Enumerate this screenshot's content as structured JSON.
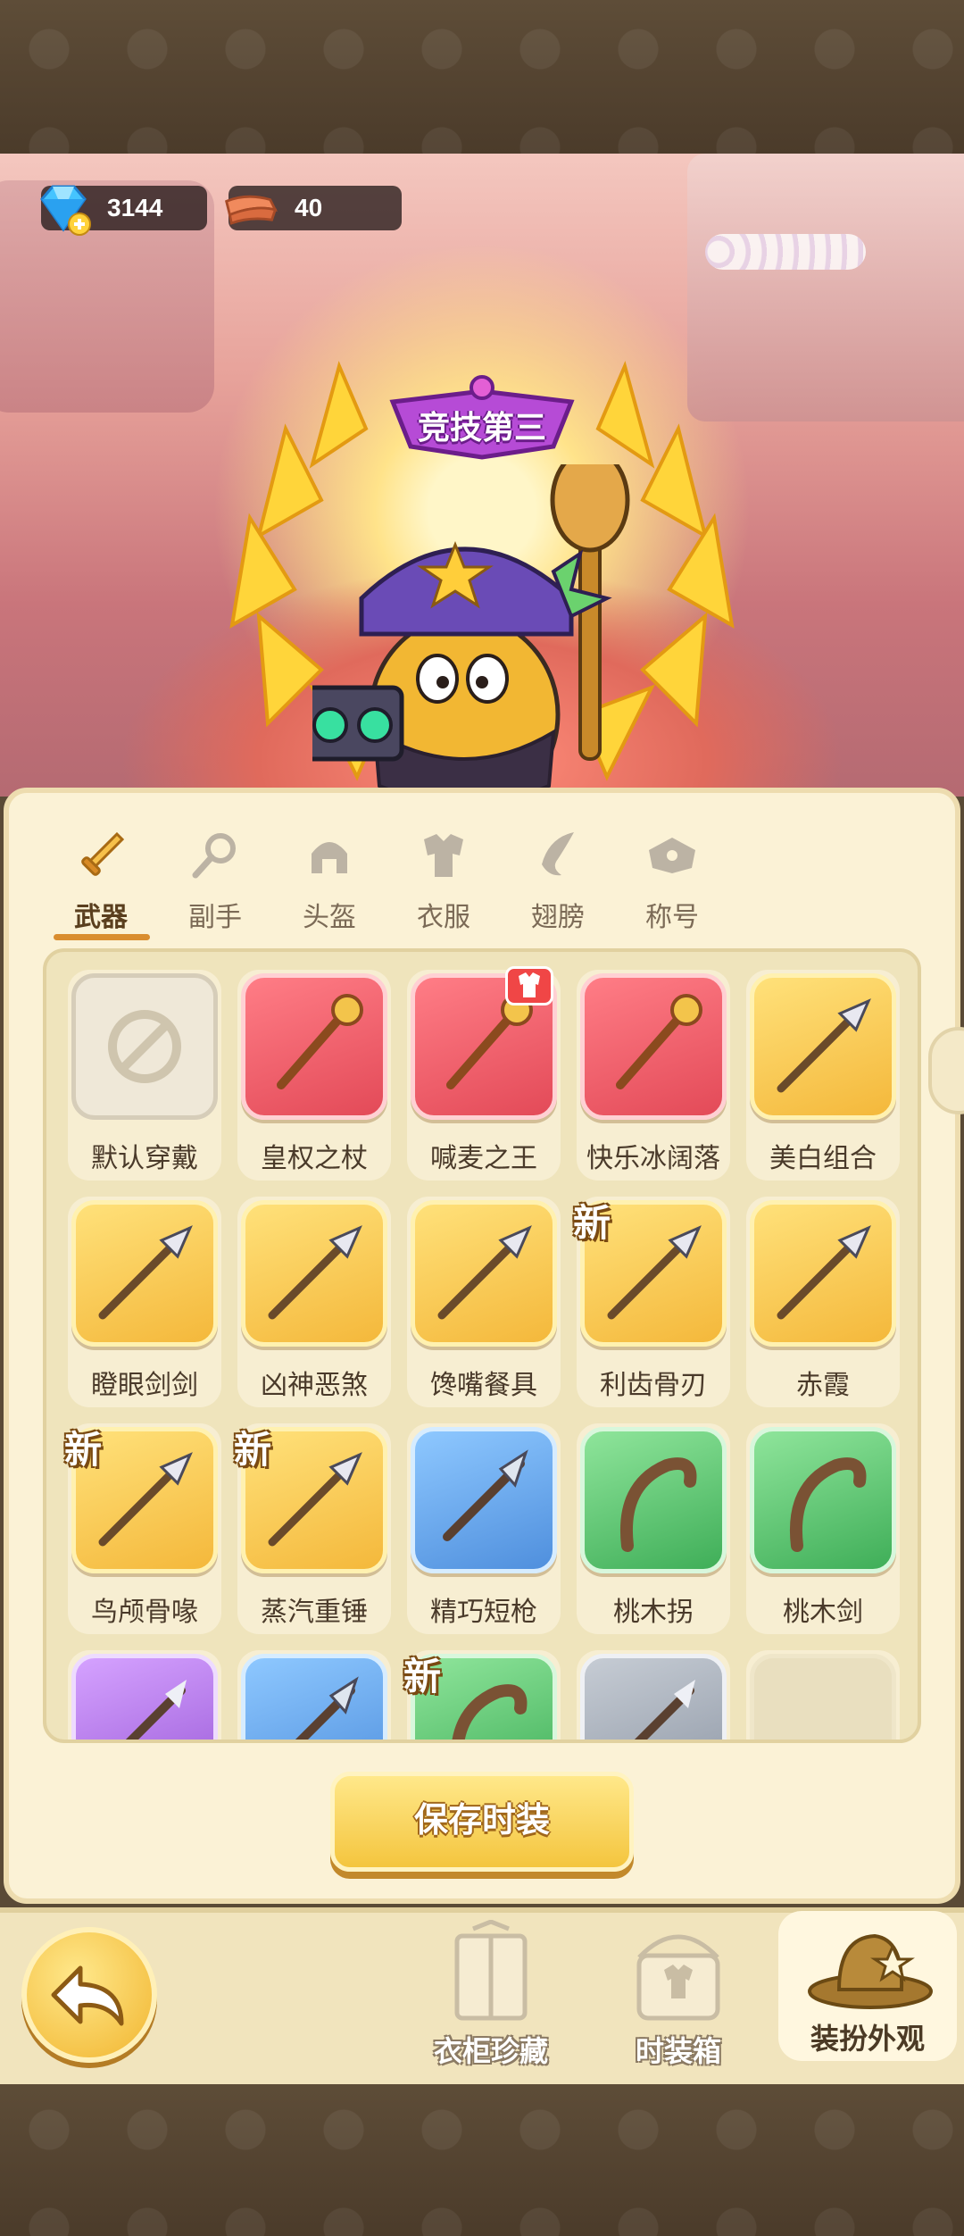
{
  "currency": {
    "gems": {
      "icon": "diamond-plus-icon",
      "value": "3144"
    },
    "material": {
      "icon": "fabric-roll-icon",
      "value": "40"
    }
  },
  "showcase": {
    "rank_title": "竞技第三"
  },
  "tabs": [
    {
      "label": "武器",
      "icon": "sword-icon",
      "active": true
    },
    {
      "label": "副手",
      "icon": "offhand-icon",
      "active": false
    },
    {
      "label": "头盔",
      "icon": "helmet-icon",
      "active": false
    },
    {
      "label": "衣服",
      "icon": "armor-icon",
      "active": false
    },
    {
      "label": "翅膀",
      "icon": "wings-icon",
      "active": false
    },
    {
      "label": "称号",
      "icon": "title-icon",
      "active": false
    }
  ],
  "items": [
    {
      "name": "默认穿戴",
      "rarity": "default",
      "new": false
    },
    {
      "name": "皇权之杖",
      "rarity": "red",
      "new": false
    },
    {
      "name": "喊麦之王",
      "rarity": "red",
      "new": false,
      "badge": "shirt-badge-icon"
    },
    {
      "name": "快乐冰阔落",
      "rarity": "red",
      "new": false
    },
    {
      "name": "美白组合",
      "rarity": "gold",
      "new": false
    },
    {
      "name": "瞪眼剑剑",
      "rarity": "gold",
      "new": false
    },
    {
      "name": "凶神恶煞",
      "rarity": "gold",
      "new": false
    },
    {
      "name": "馋嘴餐具",
      "rarity": "gold",
      "new": false
    },
    {
      "name": "利齿骨刃",
      "rarity": "gold",
      "new": true
    },
    {
      "name": "赤霞",
      "rarity": "gold",
      "new": false
    },
    {
      "name": "鸟颅骨喙",
      "rarity": "gold",
      "new": true
    },
    {
      "name": "蒸汽重锤",
      "rarity": "gold",
      "new": true
    },
    {
      "name": "精巧短枪",
      "rarity": "blue",
      "new": false
    },
    {
      "name": "桃木拐",
      "rarity": "green",
      "new": false
    },
    {
      "name": "桃木剑",
      "rarity": "green",
      "new": false
    },
    {
      "name": "",
      "rarity": "purple",
      "new": false
    },
    {
      "name": "",
      "rarity": "blue",
      "new": false
    },
    {
      "name": "",
      "rarity": "green",
      "new": true
    },
    {
      "name": "",
      "rarity": "gray",
      "new": false
    },
    {
      "name": "",
      "rarity": "empty",
      "new": false
    }
  ],
  "labels": {
    "new_tag": "新",
    "save_button": "保存时装"
  },
  "bottom_nav": [
    {
      "label": "衣柜珍藏",
      "icon": "wardrobe-book-icon",
      "active": false
    },
    {
      "label": "时装箱",
      "icon": "fashion-box-icon",
      "active": false
    },
    {
      "label": "装扮外观",
      "icon": "hat-icon",
      "active": true
    }
  ],
  "colors": {
    "accent": "#d98d2f",
    "panel_bg": "#fbf2d6",
    "gold_button": "#f4c53e"
  }
}
